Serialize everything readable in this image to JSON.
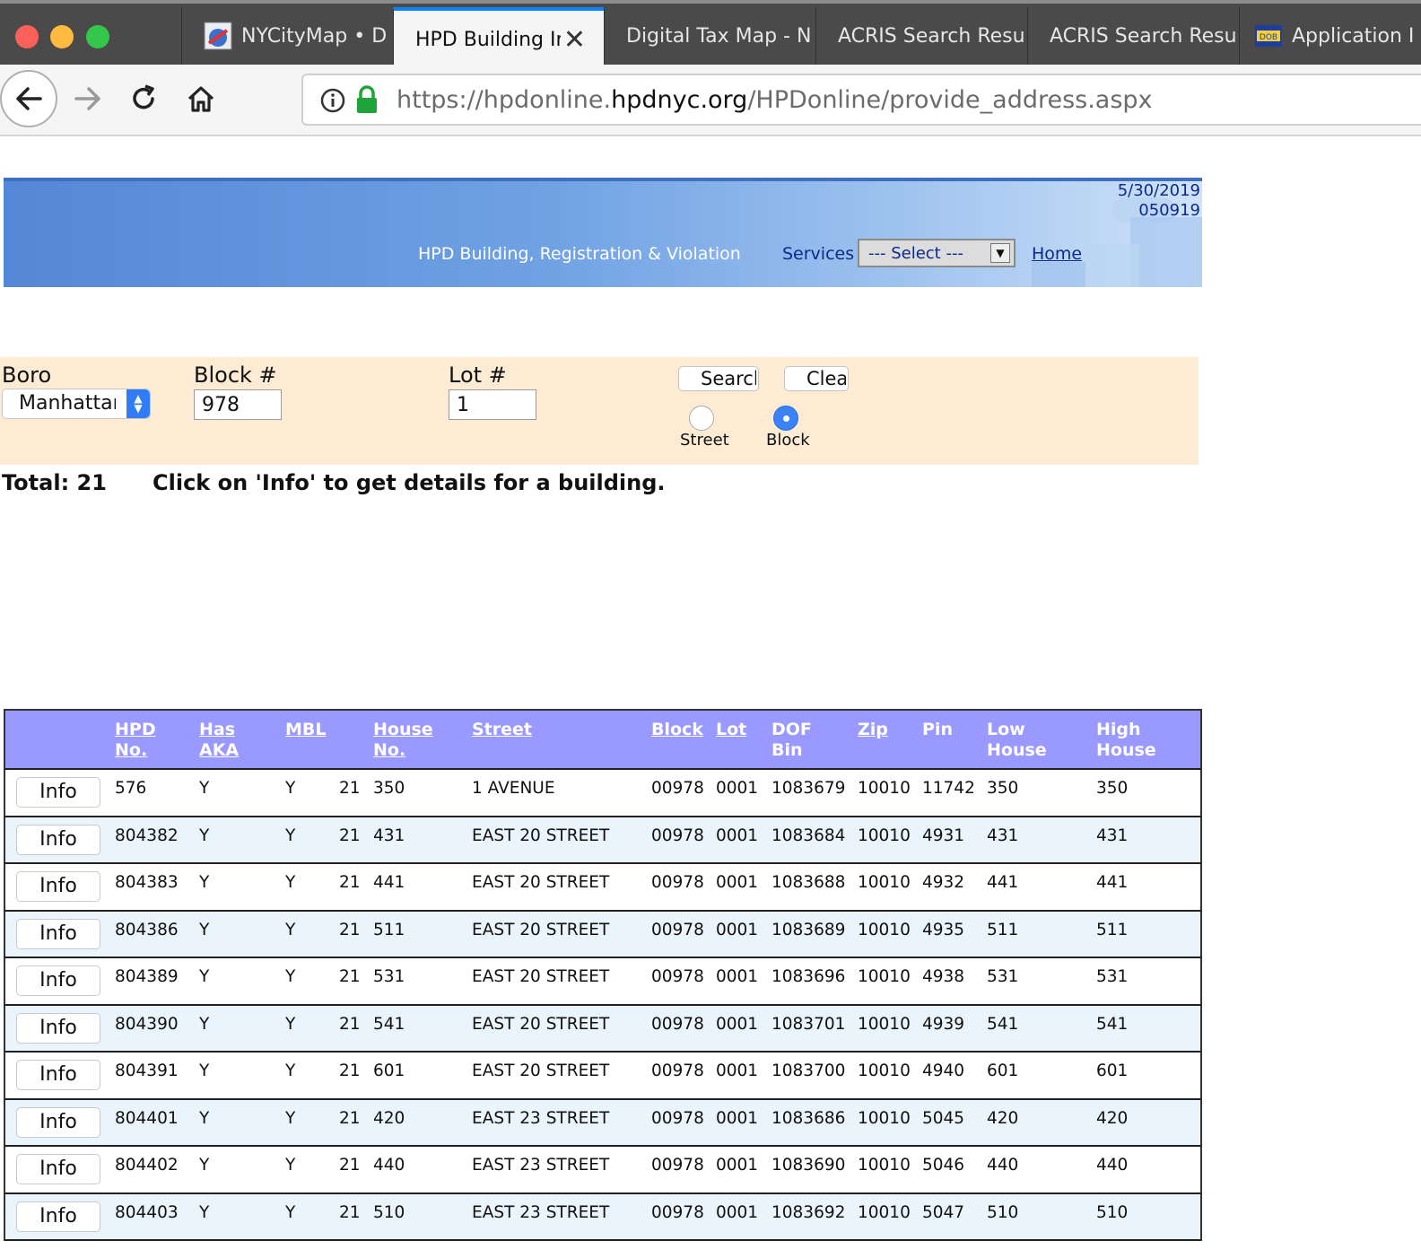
{
  "browser": {
    "tabs": [
      {
        "label": "NYCityMap • D",
        "fade": "",
        "active": false
      },
      {
        "label": "HPD Building In",
        "fade": "",
        "active": true
      },
      {
        "label": "Digital Tax Map - N",
        "fade": "",
        "active": false
      },
      {
        "label": "ACRIS Search Resu",
        "fade": "",
        "active": false
      },
      {
        "label": "ACRIS Search Resu",
        "fade": "",
        "active": false
      },
      {
        "label": "Application I",
        "fade": "",
        "active": false
      }
    ],
    "tab_close": "✕",
    "url": {
      "prefix": "https://hpdonline.",
      "domain": "hpdnyc.org",
      "path": "/HPDonline/provide_address.aspx"
    }
  },
  "header": {
    "date": "5/30/2019",
    "version": "050919",
    "title": "HPD Building, Registration & Violation",
    "services_label": "Services",
    "services_select": "--- Select ---",
    "home_link": "Home"
  },
  "search": {
    "boro_label": "Boro",
    "boro_value": "Manhattan",
    "block_label": "Block #",
    "block_value": "978",
    "lot_label": "Lot #",
    "lot_value": "1",
    "search_button": "Search",
    "clear_button": "Clear",
    "radio_street": "Street",
    "radio_block": "Block",
    "selected_mode": "Block"
  },
  "summary": {
    "total": "Total: 21",
    "hint": "Click on 'Info' to get details for a building."
  },
  "table": {
    "headers": {
      "hpd": [
        "HPD",
        "No."
      ],
      "aka": [
        "Has",
        "AKA"
      ],
      "mbl": [
        "MBL"
      ],
      "house": [
        "House",
        "No."
      ],
      "street": [
        "Street"
      ],
      "block": [
        "Block"
      ],
      "lot": [
        "Lot"
      ],
      "dof": [
        "DOF",
        "Bin"
      ],
      "zip": [
        "Zip"
      ],
      "pin": [
        "Pin"
      ],
      "low": [
        "Low",
        "House"
      ],
      "high": [
        "High",
        "House"
      ]
    },
    "info_label": "Info",
    "rows": [
      [
        "576",
        "Y",
        "Y",
        "21",
        "350",
        "1 AVENUE",
        "00978",
        "0001",
        "1083679",
        "10010",
        "11742",
        "350",
        "350"
      ],
      [
        "804382",
        "Y",
        "Y",
        "21",
        "431",
        "EAST 20 STREET",
        "00978",
        "0001",
        "1083684",
        "10010",
        "4931",
        "431",
        "431"
      ],
      [
        "804383",
        "Y",
        "Y",
        "21",
        "441",
        "EAST 20 STREET",
        "00978",
        "0001",
        "1083688",
        "10010",
        "4932",
        "441",
        "441"
      ],
      [
        "804386",
        "Y",
        "Y",
        "21",
        "511",
        "EAST 20 STREET",
        "00978",
        "0001",
        "1083689",
        "10010",
        "4935",
        "511",
        "511"
      ],
      [
        "804389",
        "Y",
        "Y",
        "21",
        "531",
        "EAST 20 STREET",
        "00978",
        "0001",
        "1083696",
        "10010",
        "4938",
        "531",
        "531"
      ],
      [
        "804390",
        "Y",
        "Y",
        "21",
        "541",
        "EAST 20 STREET",
        "00978",
        "0001",
        "1083701",
        "10010",
        "4939",
        "541",
        "541"
      ],
      [
        "804391",
        "Y",
        "Y",
        "21",
        "601",
        "EAST 20 STREET",
        "00978",
        "0001",
        "1083700",
        "10010",
        "4940",
        "601",
        "601"
      ],
      [
        "804401",
        "Y",
        "Y",
        "21",
        "420",
        "EAST 23 STREET",
        "00978",
        "0001",
        "1083686",
        "10010",
        "5045",
        "420",
        "420"
      ],
      [
        "804402",
        "Y",
        "Y",
        "21",
        "440",
        "EAST 23 STREET",
        "00978",
        "0001",
        "1083690",
        "10010",
        "5046",
        "440",
        "440"
      ],
      [
        "804403",
        "Y",
        "Y",
        "21",
        "510",
        "EAST 23 STREET",
        "00978",
        "0001",
        "1083692",
        "10010",
        "5047",
        "510",
        "510"
      ]
    ]
  },
  "colors": {
    "table_header": "#9999ff",
    "search_panel": "#fdebd3",
    "row_alt": "#eaf4fc",
    "link": "#0b2a8a"
  }
}
